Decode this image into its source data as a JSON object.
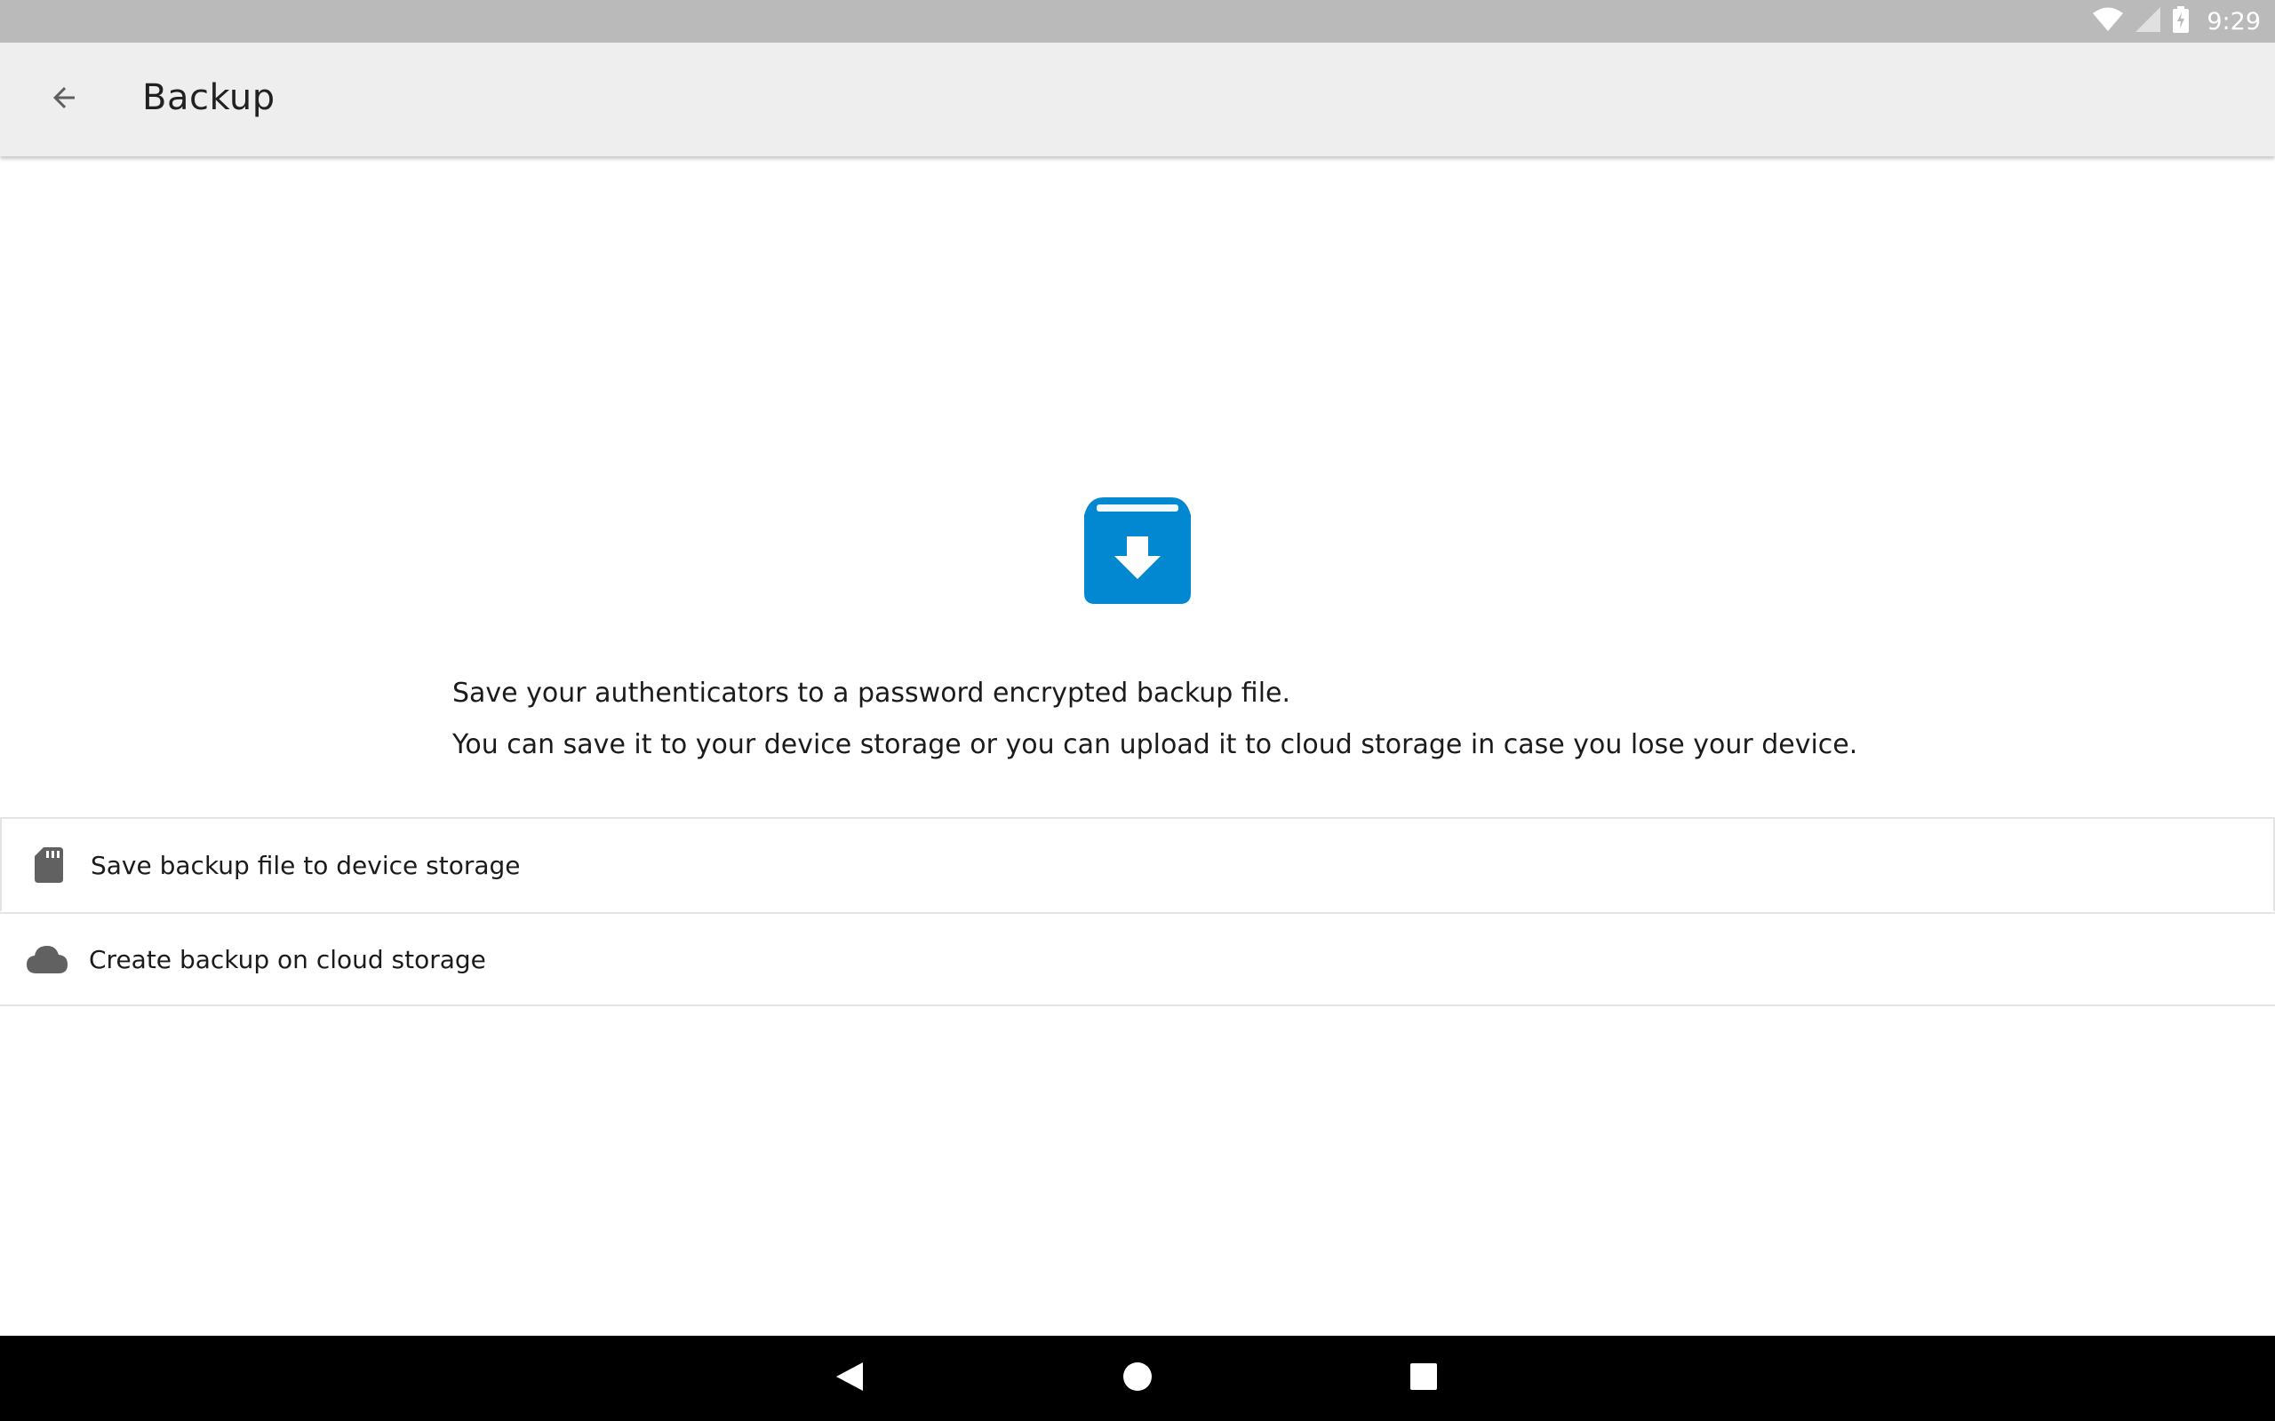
{
  "status_bar": {
    "time": "9:29",
    "icons": [
      "wifi-icon",
      "signal-icon",
      "battery-charging-icon"
    ]
  },
  "app_bar": {
    "title": "Backup",
    "back_icon": "arrow-back-icon"
  },
  "hero": {
    "icon": "archive-download-icon",
    "color": "#0288d1"
  },
  "description": {
    "line1": "Save your authenticators to a password encrypted backup file.",
    "line2": "You can save it to your device storage or you can upload it to cloud storage in case you lose your device."
  },
  "options": [
    {
      "icon": "sd-card-icon",
      "label": "Save backup file to device storage"
    },
    {
      "icon": "cloud-icon",
      "label": "Create backup on cloud storage"
    }
  ],
  "nav_bar": {
    "buttons": [
      "nav-back-icon",
      "nav-home-icon",
      "nav-recents-icon"
    ]
  }
}
